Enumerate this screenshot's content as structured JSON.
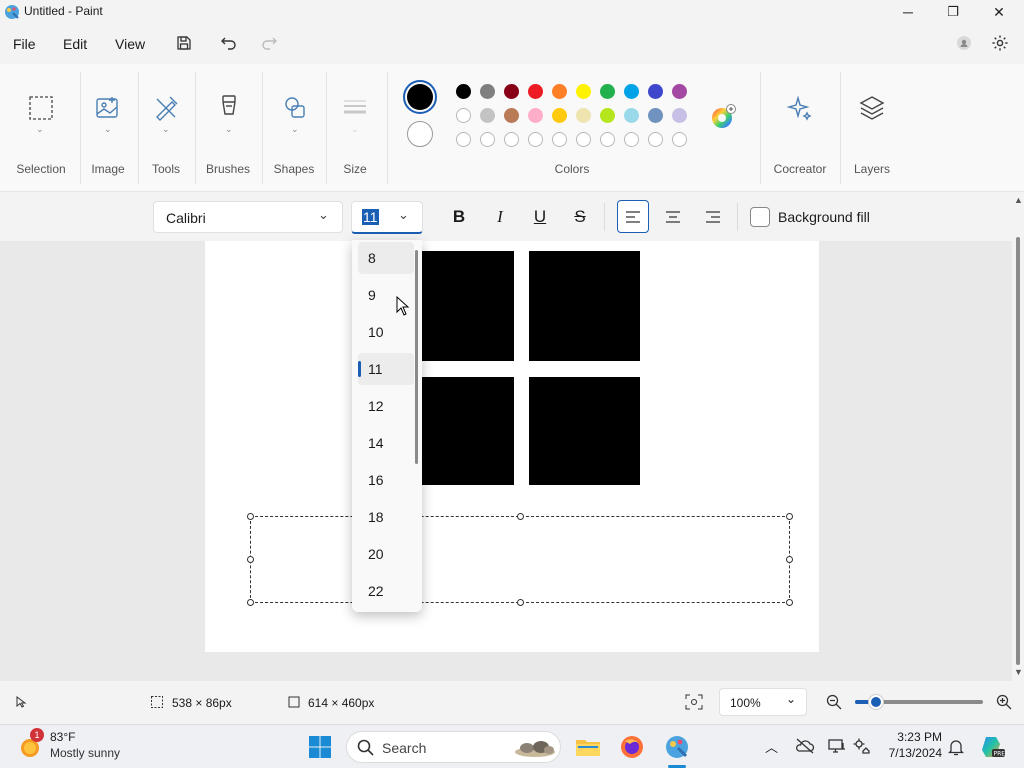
{
  "window": {
    "title": "Untitled - Paint",
    "minimize": "─",
    "maximize": "❐",
    "close": "✕"
  },
  "menu": {
    "file": "File",
    "edit": "Edit",
    "view": "View"
  },
  "ribbon": {
    "groups": {
      "selection": "Selection",
      "image": "Image",
      "tools": "Tools",
      "brushes": "Brushes",
      "shapes": "Shapes",
      "size": "Size",
      "colors": "Colors",
      "cocreator": "Cocreator",
      "layers": "Layers"
    },
    "primary_color": "#000000",
    "secondary_color": "#ffffff",
    "palette_row1": [
      "#000000",
      "#7f7f7f",
      "#880015",
      "#ed1c24",
      "#ff7f27",
      "#fff200",
      "#22b14c",
      "#00a2e8",
      "#3f48cc",
      "#a349a4"
    ],
    "palette_row2": [
      "#ffffff",
      "#c3c3c3",
      "#b97a57",
      "#ffaec9",
      "#ffc90e",
      "#efe4b0",
      "#b5e61d",
      "#99d9ea",
      "#7092be",
      "#c8bfe7"
    ]
  },
  "text_toolbar": {
    "font_family": "Calibri",
    "font_size": "11",
    "bold": "B",
    "italic": "I",
    "underline": "U",
    "strikethrough": "S",
    "background_fill": "Background fill"
  },
  "font_size_options": [
    "8",
    "9",
    "10",
    "11",
    "12",
    "14",
    "16",
    "18",
    "20",
    "22"
  ],
  "font_size_selected": "11",
  "statusbar": {
    "selection_size": "538 × 86px",
    "canvas_size": "614 × 460px",
    "zoom": "100%"
  },
  "taskbar": {
    "weather_temp": "83°F",
    "weather_desc": "Mostly sunny",
    "weather_badge": "1",
    "search_placeholder": "Search",
    "time": "3:23 PM",
    "date": "7/13/2024"
  }
}
